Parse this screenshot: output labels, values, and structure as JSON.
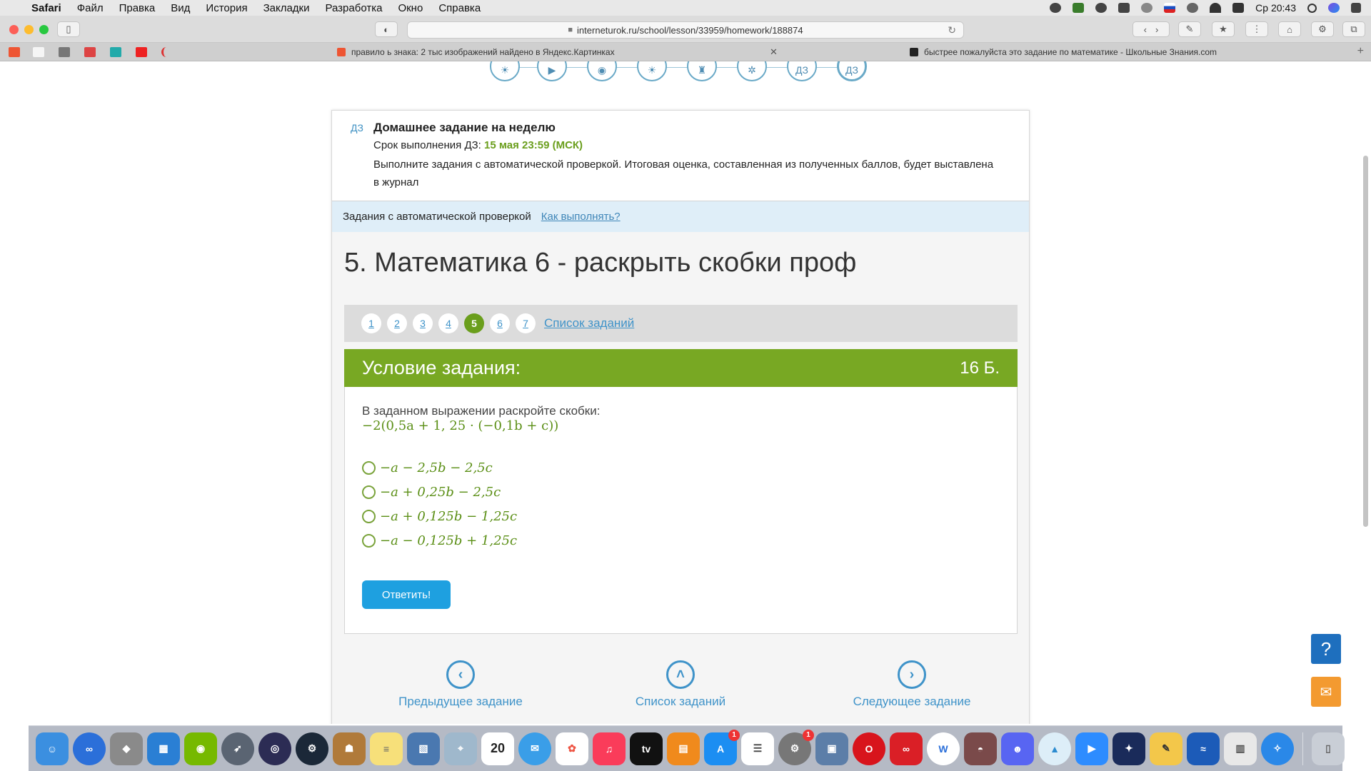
{
  "menubar": {
    "app_name": "Safari",
    "items": [
      "Файл",
      "Правка",
      "Вид",
      "История",
      "Закладки",
      "Разработка",
      "Окно",
      "Справка"
    ],
    "clock": "Ср 20:43"
  },
  "browser": {
    "url": "interneturok.ru/school/lesson/33959/homework/188874",
    "tabs": [
      {
        "title": "правило ь знака: 2 тыс изображений найдено в Яндекс.Картинках"
      },
      {
        "title": "быстрее пожалуйста это задание по математике - Школьные Знания.com"
      }
    ]
  },
  "lesson_icons": [
    "lightbulb-icon",
    "play-icon",
    "webcam-icon",
    "lightbulb-icon",
    "trophy-icon",
    "molecule-icon",
    "ДЗ",
    "ДЗ"
  ],
  "homework": {
    "badge": "ДЗ",
    "title": "Домашнее задание на неделю",
    "due_label": "Срок выполнения ДЗ:",
    "due_value": "15 мая 23:59 (МСК)",
    "description": "Выполните задания с автоматической проверкой. Итоговая оценка, составленная из полученных баллов, будет выставлена в журнал"
  },
  "auto_check": {
    "label": "Задания с автоматической проверкой",
    "how_link": "Как выполнять?"
  },
  "task": {
    "title": "5. Математика 6 - раскрыть скобки проф",
    "numbers": [
      "1",
      "2",
      "3",
      "4",
      "5",
      "6",
      "7"
    ],
    "active_index": 4,
    "list_link": "Список заданий",
    "condition_title": "Условие задания:",
    "points": "16 Б.",
    "question": "В заданном выражении раскройте скобки:",
    "expression": "−2(0,5a + 1, 25 · (−0,1b + c))",
    "options": [
      "−a − 2,5b − 2,5c",
      "−a + 0,25b − 2,5c",
      "−a + 0,125b − 1,25c",
      "−a − 0,125b + 1,25c"
    ],
    "submit_label": "Ответить!"
  },
  "bottom_nav": {
    "prev": "Предыдущее задание",
    "list": "Список заданий",
    "next": "Следующее задание"
  },
  "help": {
    "label": "?"
  },
  "colors": {
    "accent_green": "#78a823",
    "link_blue": "#3f93c9",
    "button_blue": "#1ea0e0"
  }
}
